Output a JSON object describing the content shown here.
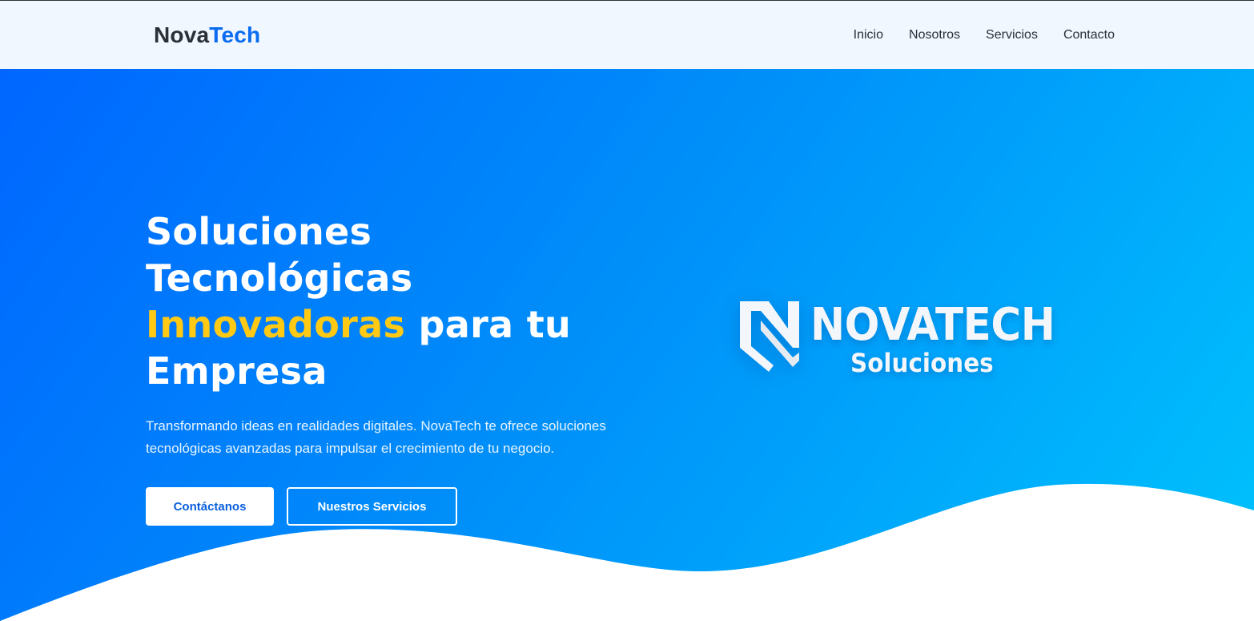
{
  "navbar": {
    "brand_part1": "Nova",
    "brand_part2": "Tech",
    "links": [
      "Inicio",
      "Nosotros",
      "Servicios",
      "Contacto"
    ]
  },
  "hero": {
    "title_line1": "Soluciones",
    "title_line2": "Tecnológicas",
    "title_accent": "Innovadoras",
    "title_line3_rest": " para tu",
    "title_line4": "Empresa",
    "subtitle": "Transformando ideas en realidades digitales. NovaTech te ofrece soluciones tecnológicas avanzadas para impulsar el crecimiento de tu negocio.",
    "primary_button": "Contáctanos",
    "secondary_button": "Nuestros Servicios"
  },
  "logo": {
    "word": "NOVATECH",
    "sub": "Soluciones"
  },
  "colors": {
    "brand_blue": "#0a6cf0",
    "accent_yellow": "#ffc914",
    "hero_gradient_start": "#0066ff",
    "hero_gradient_end": "#00c3fd",
    "navbar_bg": "#f0f7ff"
  }
}
